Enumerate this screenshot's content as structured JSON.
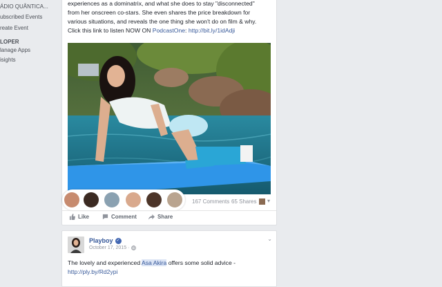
{
  "sidebar": {
    "items": [
      {
        "label": "ÁDIO QUÂNTICA..."
      },
      {
        "label": "ubscribed Events"
      },
      {
        "label": "reate Event"
      },
      {
        "label": "LOPER"
      },
      {
        "label": "lanage Apps"
      },
      {
        "label": "isights"
      }
    ]
  },
  "post1": {
    "lines": [
      "experiences as a dominatrix, and what she does to stay \"disconnected\"",
      "from her onscreen co-stars. She even shares the price breakdown for",
      "various situations, and reveals the one thing she won't do on film & why."
    ],
    "cta_prefix": "Click this link to listen NOW ON ",
    "cta_link1": "PodcastOne",
    "cta_sep": ": ",
    "cta_link2": "http://bit.ly/1idAdji",
    "comments": "167 Comments",
    "shares": "65 Shares",
    "actions": {
      "like": "Like",
      "comment": "Comment",
      "share": "Share"
    }
  },
  "post2": {
    "page_name": "Playboy",
    "date": "October 17, 2015 ·",
    "text_prefix": "The lovely and experienced ",
    "mention": "Asa Akira",
    "text_suffix": " offers some solid advice - ",
    "link": "http://ply.by/Rd2ypi"
  },
  "colors": {
    "link": "#365899",
    "muted": "#90949c",
    "pool": "#1f6f86",
    "mat": "#2f95e8"
  }
}
